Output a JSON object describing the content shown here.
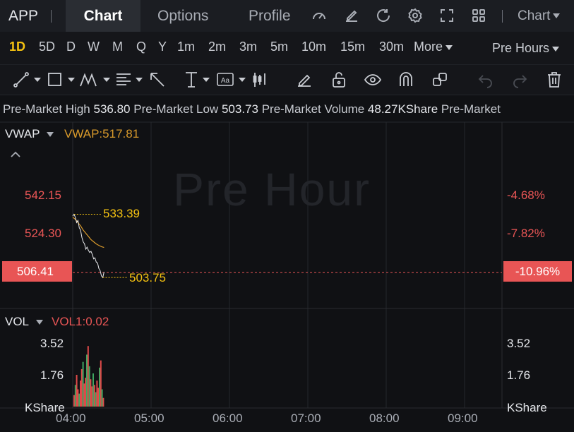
{
  "header": {
    "symbol": "APP",
    "tabs": [
      {
        "label": "Chart",
        "active": true
      },
      {
        "label": "Options",
        "active": false
      },
      {
        "label": "Profile",
        "active": false
      }
    ],
    "icons": [
      "gauge-icon",
      "edit-icon",
      "refresh-icon",
      "settings-icon",
      "fullscreen-icon",
      "grid-icon"
    ],
    "chart_menu": "Chart"
  },
  "timeframes": {
    "items": [
      "1D",
      "5D",
      "D",
      "W",
      "M",
      "Q",
      "Y",
      "1m",
      "2m",
      "3m",
      "5m",
      "10m",
      "15m",
      "30m"
    ],
    "active": "1D",
    "more": "More",
    "session": "Pre Hours"
  },
  "tools": [
    "trendline-tool",
    "rectangle-tool",
    "pattern-tool",
    "fib-tool",
    "arrow-tool",
    "measure-tool",
    "text-tool",
    "indicator-tool",
    "pencil-tool",
    "lock-tool",
    "eye-tool",
    "magnet-tool",
    "link-tool",
    "undo-tool",
    "redo-tool",
    "trash-tool"
  ],
  "info": {
    "high_label": "Pre-Market High",
    "high": "536.80",
    "low_label": "Pre-Market Low",
    "low": "503.73",
    "volume_label": "Pre-Market Volume",
    "volume": "48.27KShare",
    "trailing": "Pre-Market"
  },
  "main_panel": {
    "indicator": "VWAP",
    "indicator_value": "VWAP:517.81",
    "watermark": "Pre Hour",
    "left_ticks": [
      "542.15",
      "524.30"
    ],
    "right_ticks": [
      "-4.68%",
      "-7.82%"
    ],
    "current_price": "506.41",
    "current_pct": "-10.96%",
    "high_marker": "533.39",
    "low_marker": "503.75"
  },
  "vol_panel": {
    "indicator": "VOL",
    "indicator_value": "VOL1:0.02",
    "left_ticks": [
      "3.52",
      "1.76",
      "KShare"
    ],
    "right_ticks": [
      "3.52",
      "1.76",
      "KShare"
    ]
  },
  "time_axis": [
    "04:00",
    "05:00",
    "06:00",
    "07:00",
    "08:00",
    "09:00"
  ],
  "colors": {
    "up": "#e04a4a",
    "down": "#3fa660",
    "accent": "#f5c211",
    "vwap": "#d99a2b",
    "price_tag": "#e85555"
  },
  "chart_data": {
    "type": "line",
    "x_range": [
      "04:00",
      "09:30"
    ],
    "y_range": [
      496,
      552
    ],
    "price_series": {
      "x_minutes": [
        0,
        1,
        2,
        3,
        4,
        5,
        6,
        7,
        8,
        9,
        10,
        11,
        12,
        13,
        14,
        15,
        16,
        17,
        18,
        19,
        20,
        21,
        22,
        23,
        24
      ],
      "values": [
        532.5,
        533.39,
        532.0,
        529.5,
        530.5,
        527.0,
        526.0,
        522.5,
        520.5,
        519.5,
        517.0,
        518.0,
        516.5,
        515.5,
        516.0,
        514.5,
        512.5,
        513.0,
        511.0,
        510.5,
        508.0,
        507.0,
        504.5,
        503.75,
        506.41
      ]
    },
    "vwap_series": {
      "x_minutes": [
        0,
        2,
        4,
        6,
        8,
        10,
        12,
        14,
        16,
        18,
        20,
        22,
        24
      ],
      "values": [
        532.0,
        531.0,
        529.5,
        528.0,
        526.0,
        524.5,
        523.0,
        521.5,
        520.5,
        519.5,
        518.8,
        518.2,
        517.81
      ]
    },
    "volume_series": {
      "ylim": [
        0,
        4.6
      ],
      "values": [
        0.8,
        1.5,
        2.2,
        1.2,
        0.9,
        1.8,
        2.6,
        3.1,
        1.6,
        2.0,
        3.6,
        4.2,
        2.8,
        1.9,
        1.4,
        2.3,
        1.5,
        1.0,
        1.8,
        1.3,
        2.7,
        3.2,
        1.2,
        0.6
      ],
      "up": [
        true,
        false,
        true,
        true,
        false,
        true,
        true,
        false,
        true,
        true,
        false,
        true,
        false,
        true,
        true,
        false,
        true,
        false,
        true,
        true,
        false,
        true,
        false,
        true
      ]
    }
  }
}
